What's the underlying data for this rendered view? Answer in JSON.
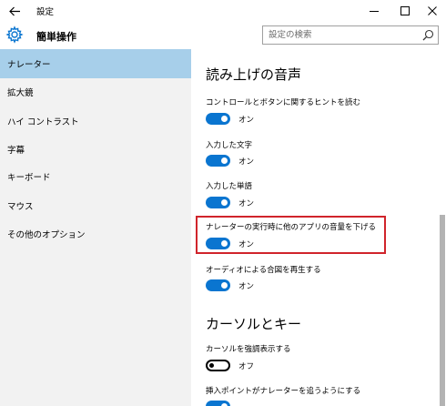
{
  "titlebar": {
    "back_icon": "back-arrow-icon",
    "title": "設定",
    "controls": [
      "minimize",
      "maximize",
      "close"
    ]
  },
  "header": {
    "icon": "gear-icon",
    "title": "簡単操作",
    "search": {
      "placeholder": "設定の検索",
      "value": ""
    }
  },
  "sidebar": {
    "items": [
      {
        "label": "ナレーター",
        "selected": true
      },
      {
        "label": "拡大鏡",
        "selected": false
      },
      {
        "label": "ハイ コントラスト",
        "selected": false
      },
      {
        "label": "字幕",
        "selected": false
      },
      {
        "label": "キーボード",
        "selected": false
      },
      {
        "label": "マウス",
        "selected": false
      },
      {
        "label": "その他のオプション",
        "selected": false
      }
    ]
  },
  "main": {
    "section1_title": "読み上げの音声",
    "settings": [
      {
        "label": "コントロールとボタンに関するヒントを読む",
        "state": "オン"
      },
      {
        "label": "入力した文字",
        "state": "オン"
      },
      {
        "label": "入力した単語",
        "state": "オン"
      },
      {
        "label": "ナレーターの実行時に他のアプリの音量を下げる",
        "state": "オン"
      },
      {
        "label": "オーディオによる合図を再生する",
        "state": "オン"
      }
    ],
    "section2_title": "カーソルとキー",
    "settings2": [
      {
        "label": "カーソルを強調表示する",
        "state": "オフ"
      },
      {
        "label": "挿入ポイントがナレーターを追うようにする",
        "state": ""
      }
    ]
  },
  "colors": {
    "accent": "#0a75d0",
    "selected_nav": "#a7cfea",
    "sidebar_bg": "#f2f2f2",
    "highlight": "#d0242b"
  }
}
